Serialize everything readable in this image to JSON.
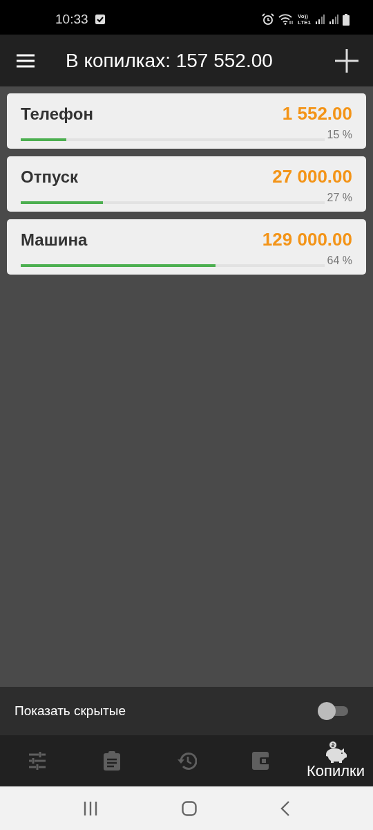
{
  "status_bar": {
    "time": "10:33",
    "network_top": "Vo))",
    "network_bottom": "LTE1"
  },
  "app_bar": {
    "title": "В копилках: 157 552.00"
  },
  "piggy_banks": [
    {
      "name": "Телефон",
      "amount": "1 552.00",
      "percent": "15 %",
      "level": 0.15
    },
    {
      "name": "Отпуск",
      "amount": "27 000.00",
      "percent": "27 %",
      "level": 0.27
    },
    {
      "name": "Машина",
      "amount": "129 000.00",
      "percent": "64 %",
      "level": 0.64
    }
  ],
  "show_hidden": {
    "label": "Показать скрытые",
    "on": false
  },
  "bottom_nav": [
    {
      "selected": false
    },
    {
      "selected": false
    },
    {
      "selected": false
    },
    {
      "selected": false
    },
    {
      "label": "Копилки",
      "selected": true
    }
  ]
}
